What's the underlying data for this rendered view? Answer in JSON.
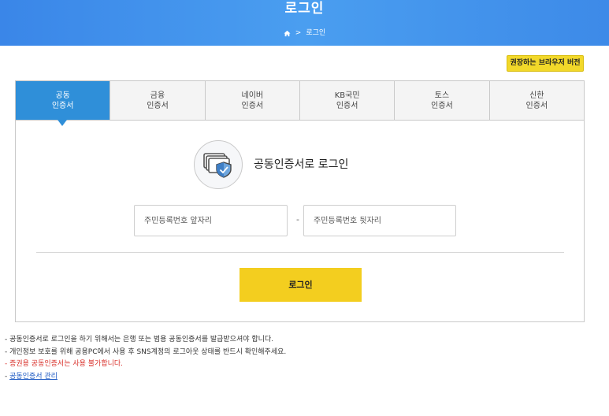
{
  "header": {
    "title": "로그인",
    "breadcrumb_sep": ">",
    "breadcrumb_current": "로그인"
  },
  "browser_button": "권장하는 브라우저 버전",
  "tabs": [
    {
      "line1": "공동",
      "line2": "인증서",
      "active": true
    },
    {
      "line1": "금융",
      "line2": "인증서",
      "active": false
    },
    {
      "line1": "네이버",
      "line2": "인증서",
      "active": false
    },
    {
      "line1": "KB국민",
      "line2": "인증서",
      "active": false
    },
    {
      "line1": "토스",
      "line2": "인증서",
      "active": false
    },
    {
      "line1": "신한",
      "line2": "인증서",
      "active": false
    }
  ],
  "main": {
    "heading": "공동인증서로 로그인",
    "rrn_front_placeholder": "주민등록번호 앞자리",
    "rrn_back_placeholder": "주민등록번호 뒷자리",
    "separator": "-",
    "login_button": "로그인"
  },
  "notes": {
    "line1": "- 공동인증서로 로그인을 하기 위해서는 은행 또는 범용 공동인증서를 발급받으셔야 합니다.",
    "line2": "- 개인정보 보호를 위해 공용PC에서 사용 후 SNS계정의 로그아웃 상태를 반드시 확인해주세요.",
    "line3": "- 증권용 공동인증서는 사용 불가합니다.",
    "line4_prefix": "- ",
    "line4_link": "공동인증서 관리"
  },
  "colors": {
    "header": "#3a86e8",
    "tab_active": "#2f8fd9",
    "login_button": "#f3ce1f",
    "notice_red": "#d9322c"
  }
}
